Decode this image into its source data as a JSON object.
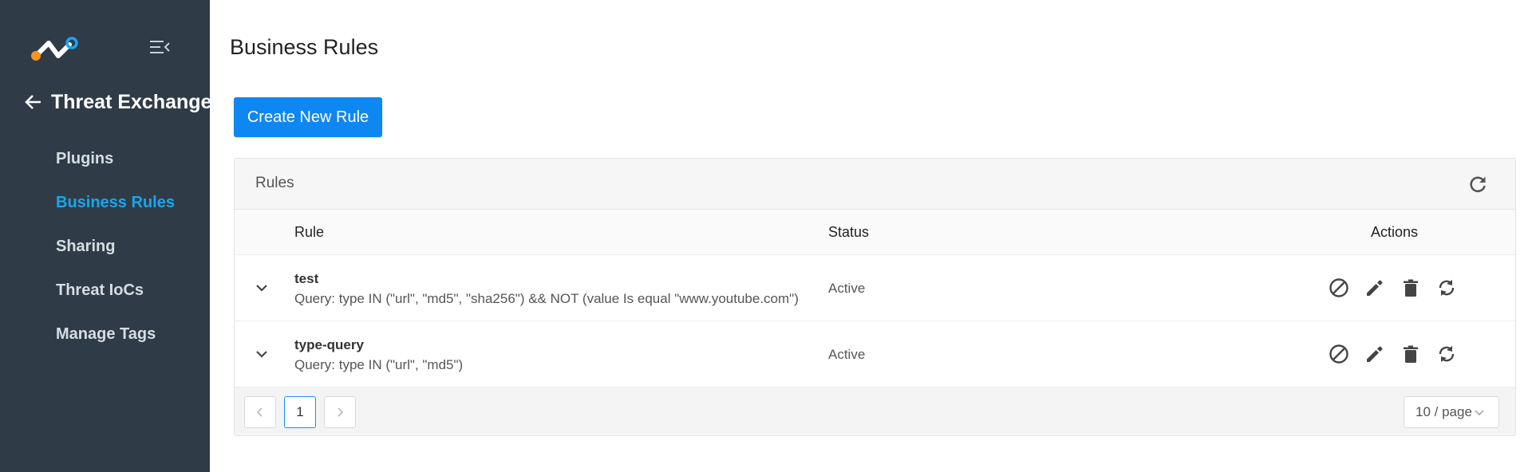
{
  "app": {
    "title": "Threat Exchange"
  },
  "colors": {
    "sidebar_bg": "#2f3c47",
    "accent": "#1aa6ee",
    "primary_button": "#0f87f2"
  },
  "sidebar": {
    "items": [
      {
        "label": "Plugins",
        "active": false
      },
      {
        "label": "Business Rules",
        "active": true
      },
      {
        "label": "Sharing",
        "active": false
      },
      {
        "label": "Threat IoCs",
        "active": false
      },
      {
        "label": "Manage Tags",
        "active": false
      }
    ]
  },
  "page": {
    "title": "Business Rules",
    "create_button": "Create New Rule"
  },
  "card": {
    "title": "Rules",
    "columns": {
      "rule": "Rule",
      "status": "Status",
      "actions": "Actions"
    },
    "rows": [
      {
        "name": "test",
        "query": "Query: type IN (\"url\", \"md5\", \"sha256\") && NOT (value Is equal \"www.youtube.com\")",
        "status": "Active"
      },
      {
        "name": "type-query",
        "query": "Query: type IN (\"url\", \"md5\")",
        "status": "Active"
      }
    ],
    "row_action_icons": [
      "disable-icon",
      "edit-icon",
      "delete-icon",
      "sync-icon"
    ]
  },
  "pagination": {
    "current_page": "1",
    "page_size": "10 / page"
  }
}
